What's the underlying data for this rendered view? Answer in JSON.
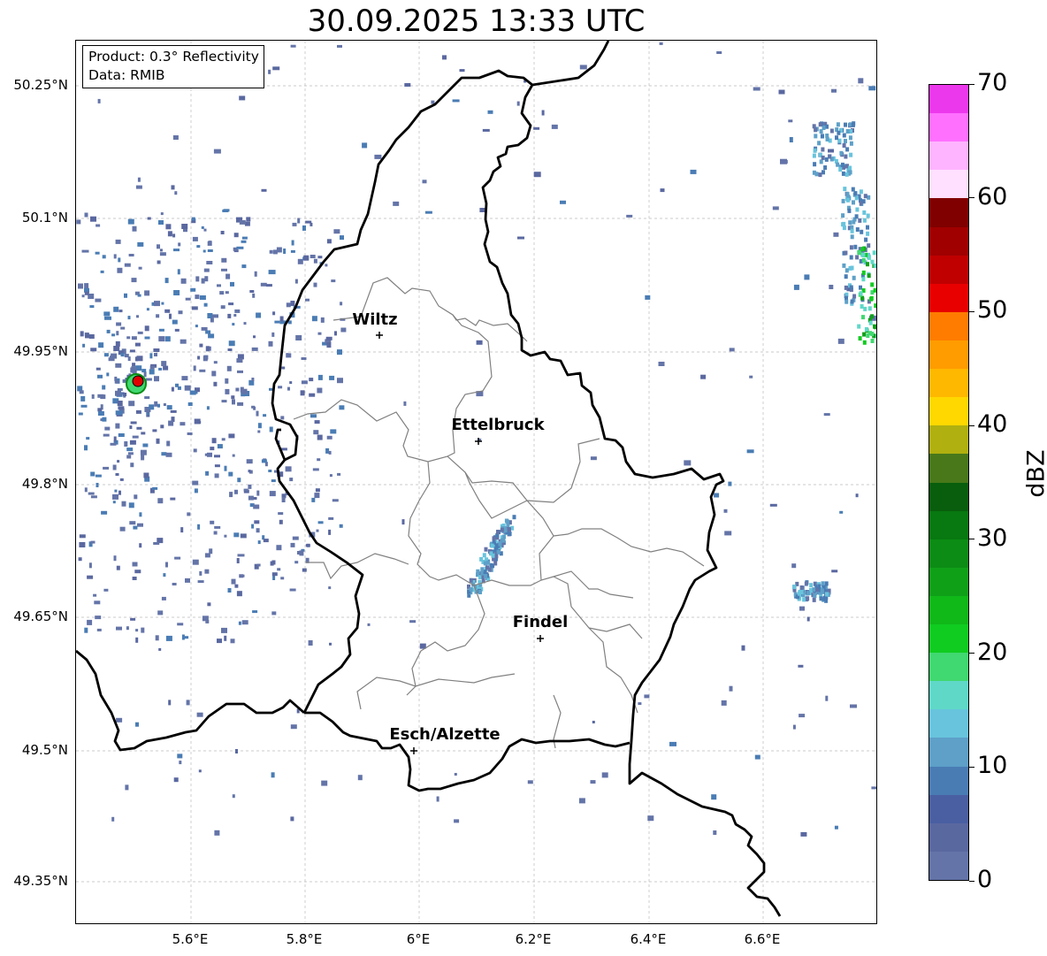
{
  "title": "30.09.2025 13:33 UTC",
  "info_box": {
    "product_line": "Product: 0.3° Reflectivity",
    "data_line": "Data: RMIB"
  },
  "map": {
    "lat_labels": [
      "50.25°N",
      "50.1°N",
      "49.95°N",
      "49.8°N",
      "49.65°N",
      "49.5°N",
      "49.35°N"
    ],
    "lon_labels": [
      "5.6°E",
      "5.8°E",
      "6°E",
      "6.2°E",
      "6.4°E",
      "6.6°E"
    ],
    "cities": [
      {
        "name": "Wiltz"
      },
      {
        "name": "Ettelbruck"
      },
      {
        "name": "Findel"
      },
      {
        "name": "Esch/Alzette"
      }
    ],
    "radar_site_marker_color": "#e00000"
  },
  "colorbar": {
    "label": "dBZ",
    "tick_labels": [
      "0",
      "10",
      "20",
      "30",
      "40",
      "50",
      "60",
      "70"
    ],
    "colors": [
      "#6474a8",
      "#5a68a0",
      "#4a5fa2",
      "#4a7cb4",
      "#5ea0c8",
      "#68c4dc",
      "#60d8c8",
      "#40d870",
      "#10cc20",
      "#10b818",
      "#10a018",
      "#0c8c14",
      "#087810",
      "#085e0c",
      "#48781a",
      "#b0b010",
      "#ffd800",
      "#ffb800",
      "#ff9c00",
      "#ff7c00",
      "#e80000",
      "#c00000",
      "#a00000",
      "#800000",
      "#ffe0ff",
      "#ffb4ff",
      "#ff70ff",
      "#ec38ec"
    ]
  }
}
